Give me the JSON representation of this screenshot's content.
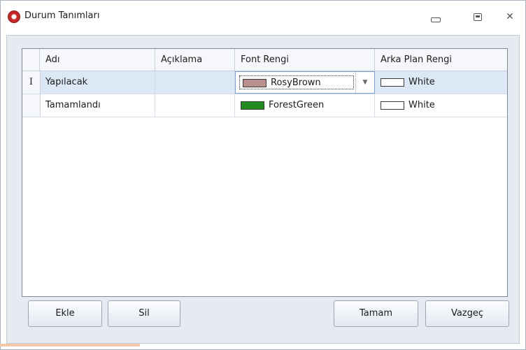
{
  "window": {
    "title": "Durum Tanımları",
    "icons": {
      "app": "app-lifebuoy-icon",
      "minimize": "minimize-icon",
      "maximize": "maximize-icon",
      "close": "close-icon"
    }
  },
  "grid": {
    "columns": [
      "Adı",
      "Açıklama",
      "Font Rengi",
      "Arka Plan Rengi"
    ],
    "rows": [
      {
        "indicator": "I",
        "name": "Yapılacak",
        "description": "",
        "font_color": {
          "label": "RosyBrown",
          "hex": "#bc8f8f"
        },
        "bg_color": {
          "label": "White",
          "hex": "#ffffff"
        },
        "selected": true
      },
      {
        "indicator": "",
        "name": "Tamamlandı",
        "description": "",
        "font_color": {
          "label": "ForestGreen",
          "hex": "#228b22"
        },
        "bg_color": {
          "label": "White",
          "hex": "#ffffff"
        },
        "selected": false
      }
    ]
  },
  "buttons": {
    "add": "Ekle",
    "delete": "Sil",
    "ok": "Tamam",
    "cancel": "Vazgeç"
  },
  "colors": {
    "selection": "#dde8f7",
    "client_bg": "#e6ebf2",
    "accent": "#7aa1d6"
  }
}
